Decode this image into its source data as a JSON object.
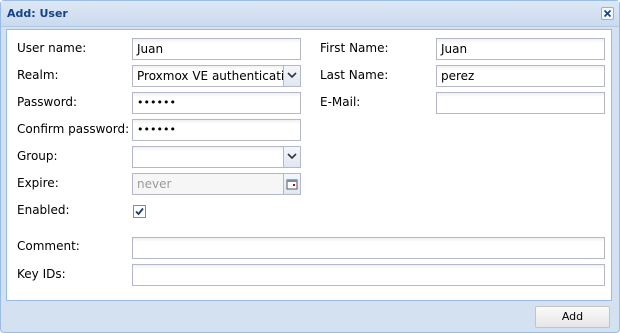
{
  "window": {
    "title": "Add: User"
  },
  "form": {
    "username": {
      "label": "User name:",
      "value": "Juan"
    },
    "realm": {
      "label": "Realm:",
      "value": "Proxmox VE authenticatior"
    },
    "password": {
      "label": "Password:",
      "value": "••••••"
    },
    "confirm_password": {
      "label": "Confirm password:",
      "value": "••••••"
    },
    "group": {
      "label": "Group:",
      "value": ""
    },
    "expire": {
      "label": "Expire:",
      "placeholder": "never"
    },
    "enabled": {
      "label": "Enabled:",
      "checked": true
    },
    "first_name": {
      "label": "First Name:",
      "value": "Juan"
    },
    "last_name": {
      "label": "Last Name:",
      "value": "perez"
    },
    "email": {
      "label": "E-Mail:",
      "value": ""
    },
    "comment": {
      "label": "Comment:",
      "value": ""
    },
    "key_ids": {
      "label": "Key IDs:",
      "value": ""
    }
  },
  "buttons": {
    "add_label": "Add"
  },
  "icons": {
    "close": "close-icon",
    "combo": "chevron-down-icon",
    "date": "calendar-icon",
    "check": "checkmark-icon"
  },
  "colors": {
    "title": "#15428b",
    "border": "#99bbe8",
    "frame": "#d3e1f1"
  }
}
